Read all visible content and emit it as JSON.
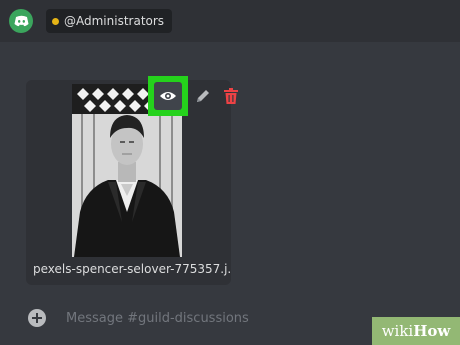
{
  "header": {
    "role_mention": "@Administrators",
    "role_color": "#e5b416",
    "logo_icon": "discord-icon"
  },
  "attachment": {
    "filename": "pexels-spencer-selover-775357.j...",
    "actions": [
      {
        "name": "preview",
        "icon": "eye-icon",
        "highlighted": true
      },
      {
        "name": "edit",
        "icon": "pencil-icon"
      },
      {
        "name": "delete",
        "icon": "trash-icon"
      }
    ]
  },
  "composer": {
    "placeholder": "Message #guild-discussions",
    "add_icon": "plus-circle-icon"
  },
  "watermark": {
    "prefix": "wiki",
    "suffix": "How"
  },
  "colors": {
    "highlight": "#25d21c",
    "delete": "#ed4245",
    "background": "#36393f"
  }
}
